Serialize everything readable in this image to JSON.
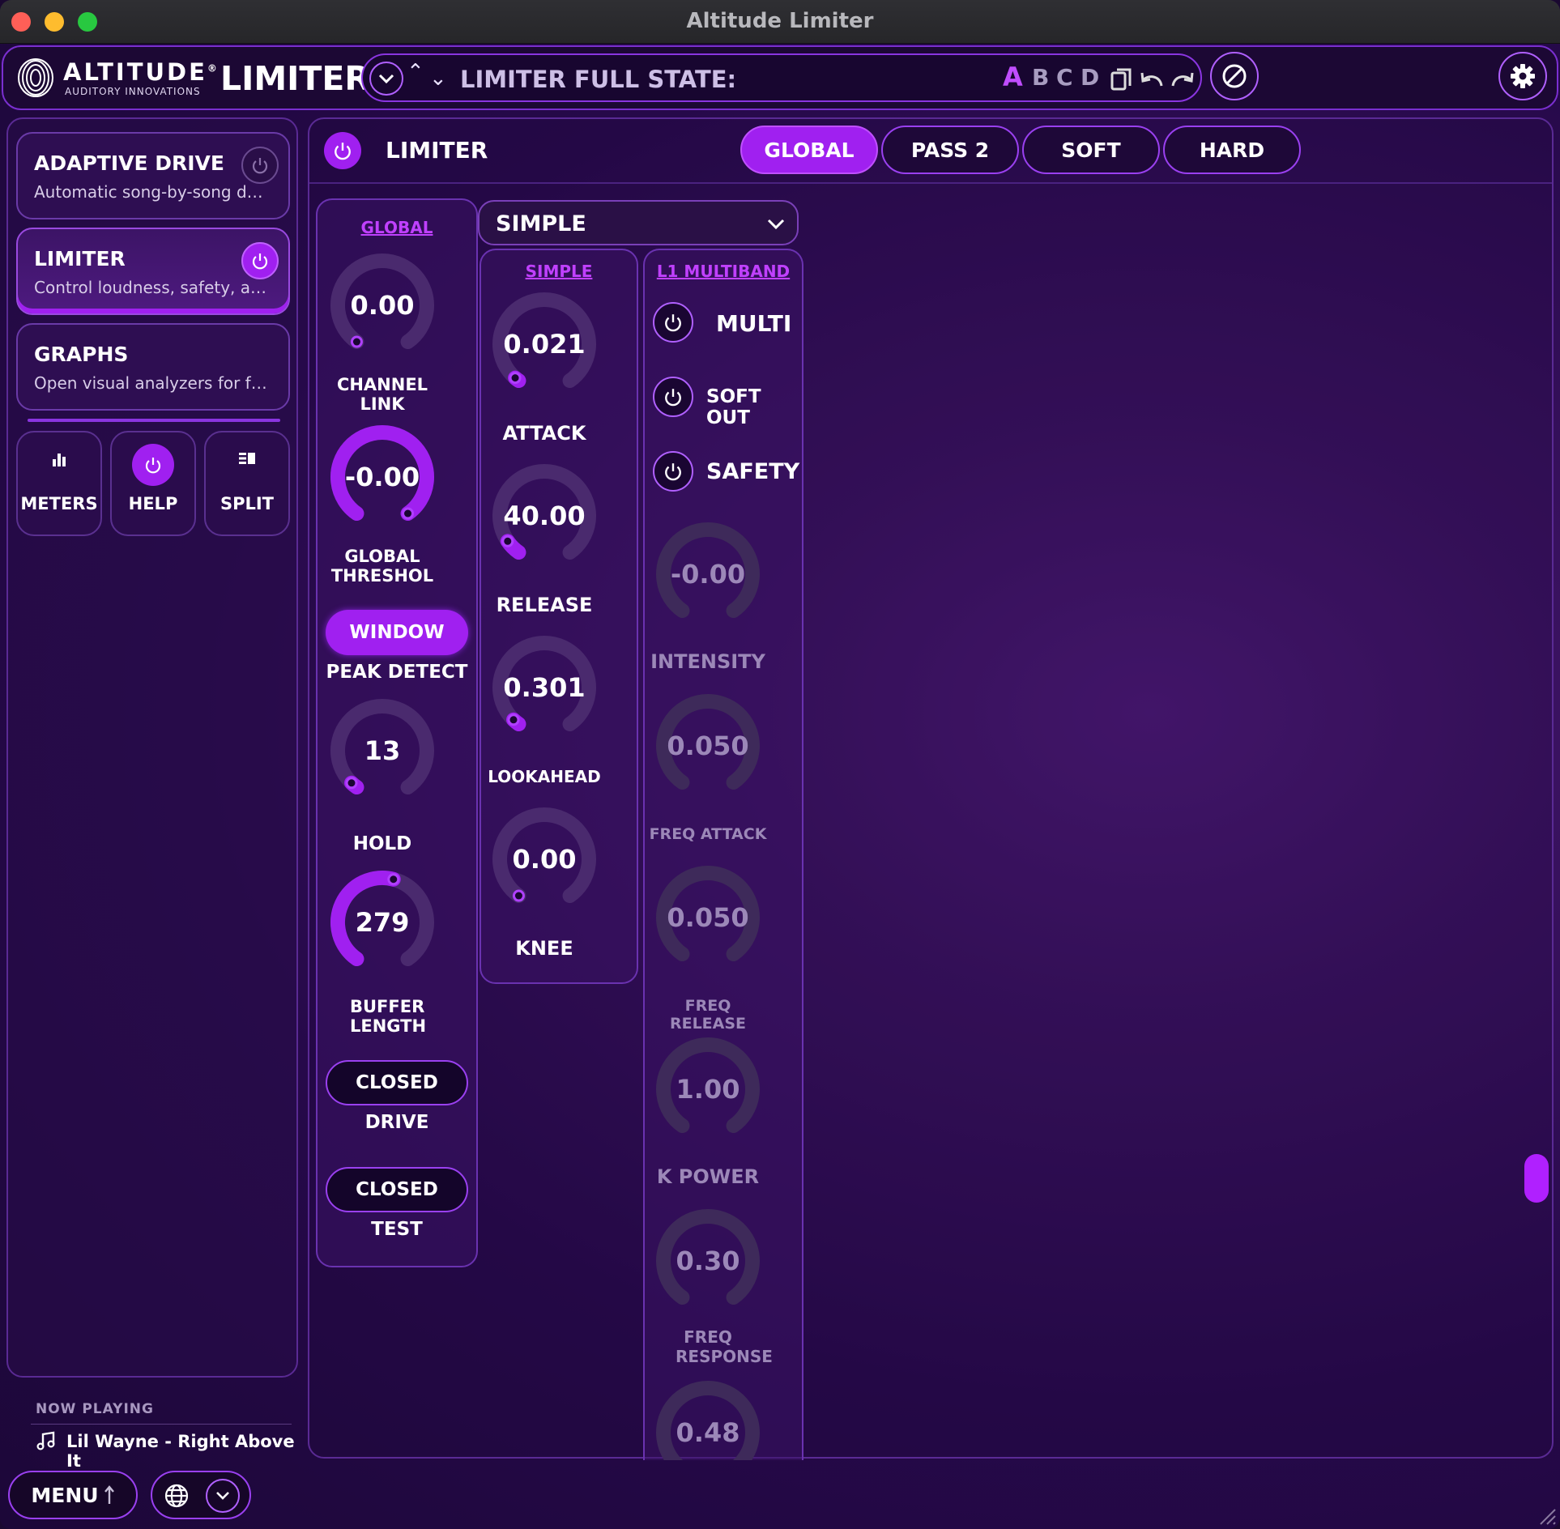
{
  "window": {
    "title": "Altitude Limiter"
  },
  "header": {
    "brand": "ALTITUDE",
    "brand_reg": "®",
    "brand_sub": "AUDITORY INNOVATIONS",
    "product": "LIMITER",
    "state_label": "LIMITER FULL STATE:",
    "slots": [
      "A",
      "B",
      "C",
      "D"
    ],
    "active_slot": "A"
  },
  "sidebar": {
    "cards": [
      {
        "title": "ADAPTIVE DRIVE",
        "desc": "Automatic song-by-song drive ...",
        "power": false
      },
      {
        "title": "LIMITER",
        "desc": "Control loudness, safety, and li...",
        "power": true
      },
      {
        "title": "GRAPHS",
        "desc": "Open visual analyzers for freque..."
      }
    ],
    "buttons": [
      {
        "label": "METERS",
        "icon": "bar-chart-icon"
      },
      {
        "label": "HELP",
        "icon": "power-icon",
        "active": true
      },
      {
        "label": "SPLIT",
        "icon": "split-icon"
      }
    ],
    "now_playing": {
      "label": "NOW PLAYING",
      "track": "Lil Wayne - Right Above It"
    }
  },
  "main": {
    "title": "LIMITER",
    "power": true,
    "tabs": [
      "GLOBAL",
      "PASS 2",
      "SOFT",
      "HARD"
    ],
    "active_tab": "GLOBAL",
    "global": {
      "header": "GLOBAL",
      "knobs": [
        {
          "value": "0.00",
          "label": "CHANNEL LINK",
          "fill": 0.0
        },
        {
          "value": "-0.00",
          "label": "GLOBAL THRESHOL",
          "fill": 1.0
        },
        {
          "value": "13",
          "label": "HOLD",
          "fill": 0.03
        },
        {
          "value": "279",
          "label": "BUFFER LENGTH",
          "fill": 0.55
        }
      ],
      "peak_detect": {
        "value": "WINDOW",
        "label": "PEAK DETECT"
      },
      "drive": {
        "value": "CLOSED",
        "label": "DRIVE"
      },
      "test": {
        "value": "CLOSED",
        "label": "TEST"
      }
    },
    "mode_select": {
      "value": "SIMPLE"
    },
    "simple": {
      "header": "SIMPLE",
      "knobs": [
        {
          "value": "0.021",
          "label": "ATTACK",
          "fill": 0.02
        },
        {
          "value": "40.00",
          "label": "RELEASE",
          "fill": 0.07
        },
        {
          "value": "0.301",
          "label": "LOOKAHEAD",
          "fill": 0.03
        },
        {
          "value": "0.00",
          "label": "KNEE",
          "fill": 0.0
        }
      ]
    },
    "multiband": {
      "header": "L1 MULTIBAND",
      "toggles": [
        {
          "label": "MULTI"
        },
        {
          "label": "SOFT OUT"
        },
        {
          "label": "SAFETY"
        }
      ],
      "knobs": [
        {
          "value": "-0.00",
          "label": "INTENSITY"
        },
        {
          "value": "0.050",
          "label": "FREQ ATTACK"
        },
        {
          "value": "0.050",
          "label": "FREQ RELEASE"
        },
        {
          "value": "1.00",
          "label": "K POWER"
        },
        {
          "value": "0.30",
          "label": "FREQ RESPONSE"
        },
        {
          "value": "0.48",
          "label": ""
        }
      ]
    }
  },
  "footer": {
    "menu_label": "MENU"
  },
  "colors": {
    "accent": "#a020f0",
    "background": "#26094a",
    "border": "#7a2fd0"
  }
}
